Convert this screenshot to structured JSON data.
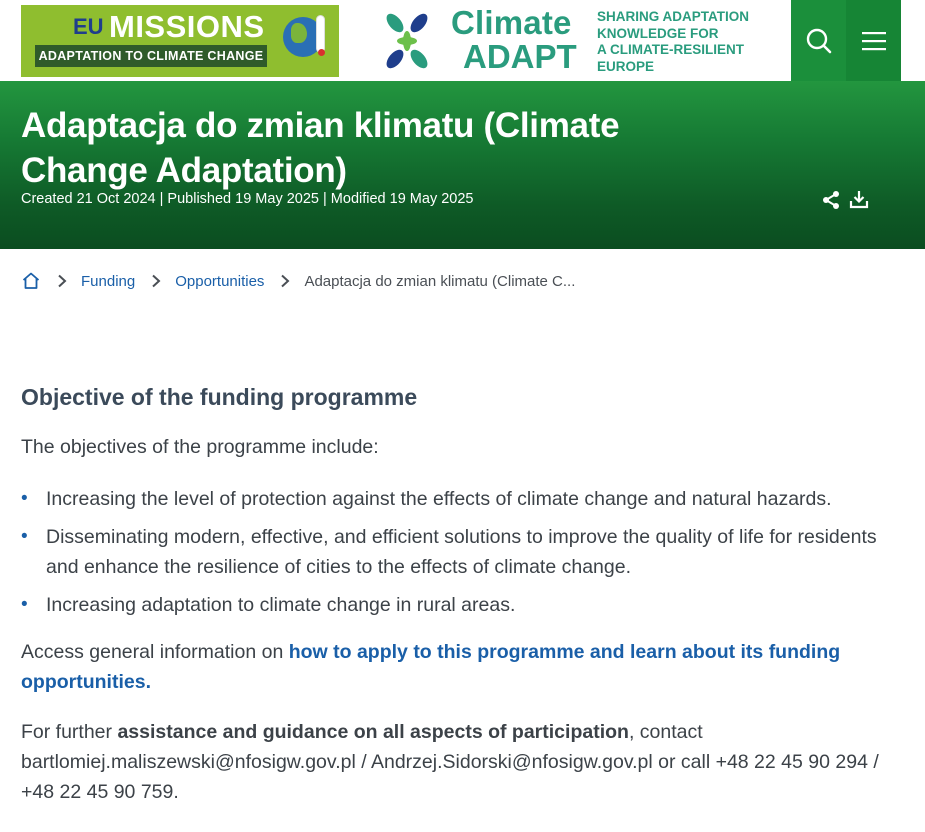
{
  "header": {
    "eu_logo": {
      "eu": "EU",
      "missions": "MISSIONS",
      "subtitle": "ADAPTATION TO CLIMATE CHANGE"
    },
    "ca_logo": {
      "line1": "Climate",
      "line2": "ADAPT"
    },
    "tagline": [
      "SHARING ADAPTATION",
      "KNOWLEDGE FOR",
      "A CLIMATE-RESILIENT",
      "EUROPE"
    ],
    "colors": {
      "brand_green": "#1b8f3b",
      "ca_teal": "#2a9c7e",
      "eu_lime": "#8fbe2f",
      "link_blue": "#1a5fa8"
    }
  },
  "hero": {
    "title": "Adaptacja do zmian klimatu (Climate Change Adaptation)",
    "meta": "Created 21 Oct 2024 | Published 19 May 2025 | Modified 19 May 2025",
    "icons": {
      "share": "share-icon",
      "download": "download-icon"
    }
  },
  "breadcrumb": {
    "items": [
      {
        "label": "Funding"
      },
      {
        "label": "Opportunities"
      }
    ],
    "current": "Adaptacja do zmian klimatu (Climate C..."
  },
  "content": {
    "section_title": "Objective of the funding programme",
    "intro": "The objectives of the programme include:",
    "bullets": [
      "Increasing the level of protection against the effects of climate change and natural hazards.",
      "Disseminating modern, effective, and efficient solutions to improve the quality of life for residents and enhance the resilience of cities to the effects of climate change.",
      "Increasing adaptation to climate change in rural areas."
    ],
    "access": {
      "prefix": "Access general information on ",
      "link": "how to apply to this programme and learn about its funding opportunities."
    },
    "contact": {
      "prefix": "For further ",
      "bold": "assistance and guidance on all aspects of participation",
      "suffix": ", contact bartlomiej.maliszewski@nfosigw.gov.pl / Andrzej.Sidorski@nfosigw.gov.pl or call +48 22 45 90 294 / +48 22 45 90 759."
    }
  }
}
